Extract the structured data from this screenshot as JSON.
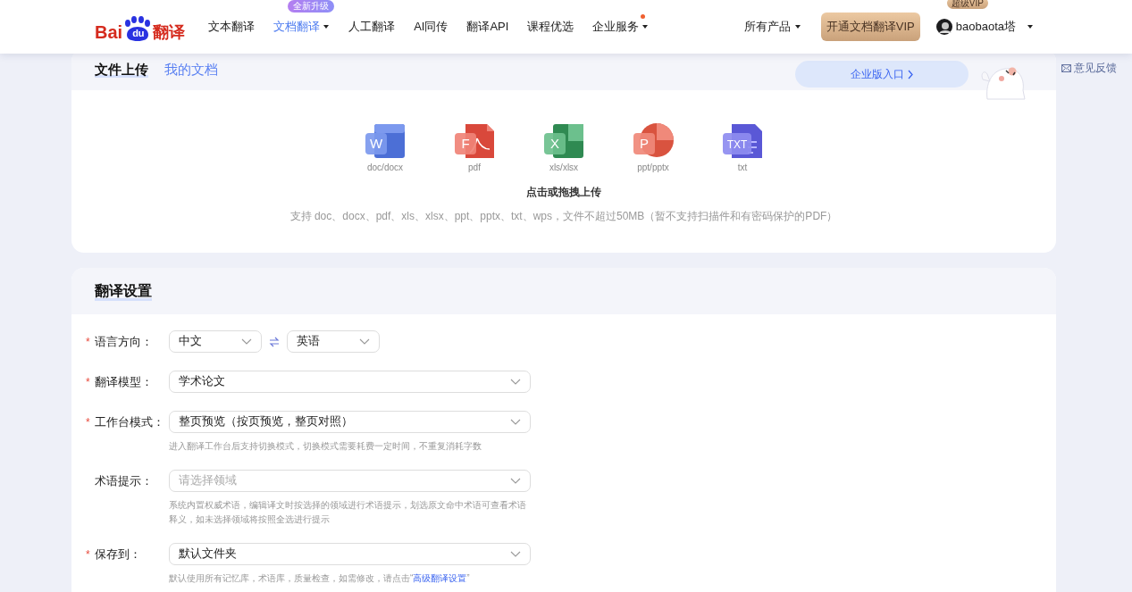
{
  "logo": {
    "text_left": "Bai",
    "paw_text": "du",
    "text_right": "翻译"
  },
  "nav": [
    {
      "label": "文本翻译",
      "selected": false,
      "dropdown": false,
      "dot": false
    },
    {
      "label": "文档翻译",
      "selected": true,
      "dropdown": true,
      "badge": "全新升级",
      "dot": false
    },
    {
      "label": "人工翻译",
      "selected": false,
      "dropdown": false,
      "dot": false
    },
    {
      "label": "AI同传",
      "selected": false,
      "dropdown": false,
      "dot": false
    },
    {
      "label": "翻译API",
      "selected": false,
      "dropdown": false,
      "dot": false
    },
    {
      "label": "课程优选",
      "selected": false,
      "dropdown": false,
      "dot": false
    },
    {
      "label": "企业服务",
      "selected": false,
      "dropdown": true,
      "dot": true
    }
  ],
  "all_products": "所有产品",
  "vip_button": "开通文档翻译VIP",
  "user": {
    "name": "baobaota塔",
    "badge": "超级VIP"
  },
  "upload": {
    "tabs": [
      {
        "label": "文件上传",
        "selected": true
      },
      {
        "label": "我的文档",
        "selected": false
      }
    ],
    "enterprise_link": "企业版入口",
    "file_types": [
      {
        "kind": "word",
        "badge": "W",
        "label": "doc/docx"
      },
      {
        "kind": "pdf",
        "badge": "F",
        "label": "pdf"
      },
      {
        "kind": "excel",
        "badge": "X",
        "label": "xls/xlsx"
      },
      {
        "kind": "ppt",
        "badge": "P",
        "label": "ppt/pptx"
      },
      {
        "kind": "txt",
        "badge": "TXT",
        "label": "txt"
      }
    ],
    "prompt": "点击或拖拽上传",
    "note": "支持 doc、docx、pdf、xls、xlsx、ppt、pptx、txt、wps，文件不超过50MB（暂不支持扫描件和有密码保护的PDF）"
  },
  "feedback": "意见反馈",
  "settings": {
    "title": "翻译设置",
    "required_mark": "*",
    "rows": [
      {
        "kind": "language",
        "required": true,
        "label": "语言方向：",
        "source": "中文",
        "target": "英语"
      },
      {
        "kind": "select",
        "required": true,
        "label": "翻译模型：",
        "value": "学术论文"
      },
      {
        "kind": "select",
        "required": true,
        "label": "工作台模式：",
        "value": "整页预览（按页预览，整页对照）",
        "hint": "进入翻译工作台后支持切换模式，切换模式需要耗费一定时间，不重复消耗字数"
      },
      {
        "kind": "select",
        "required": false,
        "label": "术语提示：",
        "placeholder": "请选择领域",
        "hint": "系统内置权威术语，编辑译文时按选择的领域进行术语提示，划选原文命中术语可查看术语释义，如未选择领域将按照全选进行提示"
      },
      {
        "kind": "select",
        "required": true,
        "label": "保存到：",
        "value": "默认文件夹",
        "hint": "默认使用所有记忆库，术语库，质量检查，如需修改，请点击“",
        "hint_link": "高级翻译设置",
        "hint_after": "”"
      }
    ]
  }
}
